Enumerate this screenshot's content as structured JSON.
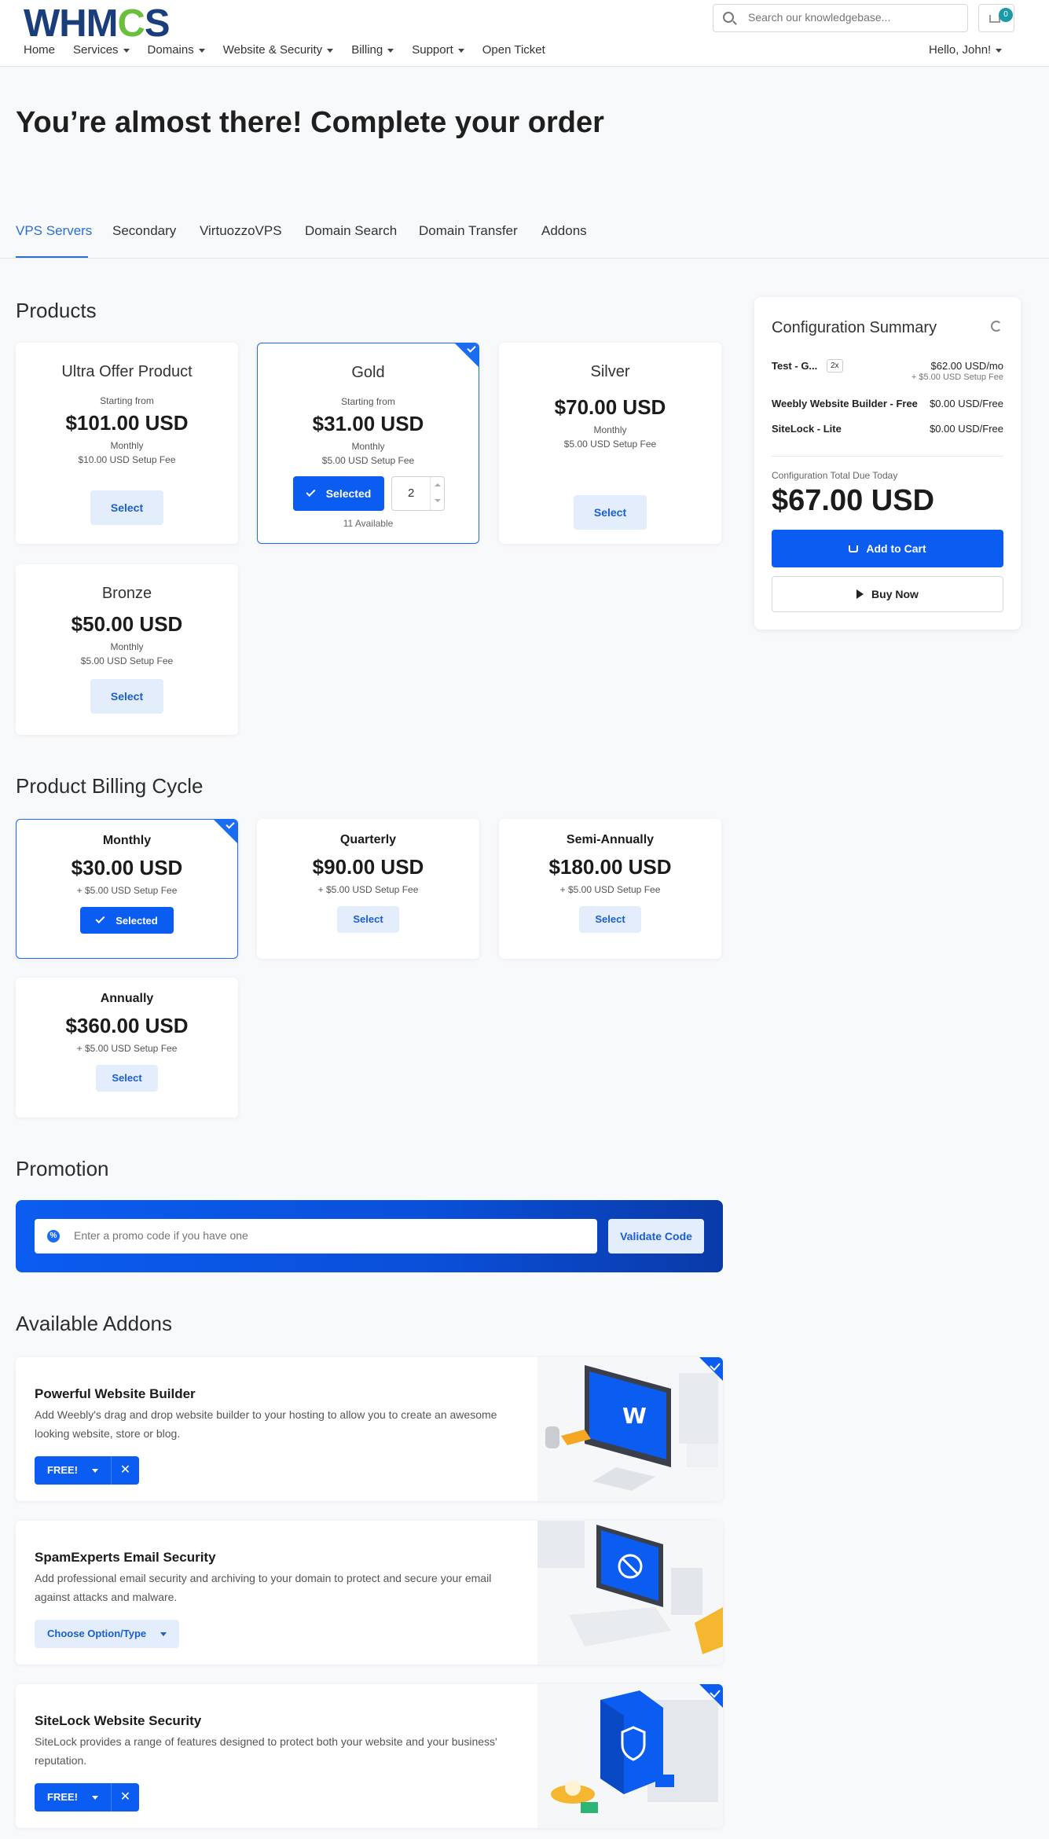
{
  "brand": {
    "logo_text_a": "WHM",
    "logo_text_b": "C",
    "logo_text_c": "S"
  },
  "header": {
    "search_placeholder": "Search our knowledgebase...",
    "cart_count": "0",
    "nav": [
      {
        "label": "Home",
        "dropdown": false
      },
      {
        "label": "Services",
        "dropdown": true
      },
      {
        "label": "Domains",
        "dropdown": true
      },
      {
        "label": "Website & Security",
        "dropdown": true
      },
      {
        "label": "Billing",
        "dropdown": true
      },
      {
        "label": "Support",
        "dropdown": true
      },
      {
        "label": "Open Ticket",
        "dropdown": false
      }
    ],
    "greeting": "Hello, John!"
  },
  "page": {
    "title": "You’re almost there! Complete your order"
  },
  "tabs": [
    "VPS Servers",
    "Secondary",
    "VirtuozzoVPS",
    "Domain Search",
    "Domain Transfer",
    "Addons"
  ],
  "products": {
    "heading": "Products",
    "items": [
      {
        "name": "Ultra Offer Product",
        "from": "Starting from",
        "price": "$101.00 USD",
        "cycle": "Monthly",
        "setup": "$10.00 USD Setup Fee",
        "button": "Select"
      },
      {
        "name": "Gold",
        "from": "Starting from",
        "price": "$31.00 USD",
        "cycle": "Monthly",
        "setup": "$5.00 USD Setup Fee",
        "button": "Selected",
        "qty": "2",
        "available": "11 Available"
      },
      {
        "name": "Silver",
        "price": "$70.00 USD",
        "cycle": "Monthly",
        "setup": "$5.00 USD Setup Fee",
        "button": "Select"
      },
      {
        "name": "Bronze",
        "price": "$50.00 USD",
        "cycle": "Monthly",
        "setup": "$5.00 USD Setup Fee",
        "button": "Select"
      }
    ]
  },
  "billing": {
    "heading": "Product Billing Cycle",
    "items": [
      {
        "name": "Monthly",
        "price": "$30.00 USD",
        "setup": "+ $5.00 USD Setup Fee",
        "button": "Selected"
      },
      {
        "name": "Quarterly",
        "price": "$90.00 USD",
        "setup": "+ $5.00 USD Setup Fee",
        "button": "Select"
      },
      {
        "name": "Semi-Annually",
        "price": "$180.00 USD",
        "setup": "+ $5.00 USD Setup Fee",
        "button": "Select"
      },
      {
        "name": "Annually",
        "price": "$360.00 USD",
        "setup": "+ $5.00 USD Setup Fee",
        "button": "Select"
      }
    ]
  },
  "promotion": {
    "heading": "Promotion",
    "placeholder": "Enter a promo code if you have one",
    "button": "Validate Code"
  },
  "addons": {
    "heading": "Available Addons",
    "items": [
      {
        "name": "Powerful Website Builder",
        "desc": "Add Weebly's drag and drop website builder to your hosting to allow you to create an awesome looking website, store or blog.",
        "button": "FREE!",
        "selected": true
      },
      {
        "name": "SpamExperts Email Security",
        "desc": "Add professional email security and archiving to your domain to protect and secure your email against attacks and malware.",
        "button": "Choose Option/Type",
        "selected": false
      },
      {
        "name": "SiteLock Website Security",
        "desc": "SiteLock provides a range of features designed to protect both your website and your business' reputation.",
        "button": "FREE!",
        "selected": true
      }
    ]
  },
  "summary": {
    "title": "Configuration Summary",
    "rows": [
      {
        "label": "Test - G...",
        "qty": "2x",
        "value": "$62.00 USD/mo",
        "sub": "+ $5.00 USD Setup Fee"
      },
      {
        "label": "Weebly Website Builder - Free",
        "value": "$0.00 USD/Free"
      },
      {
        "label": "SiteLock - Lite",
        "value": "$0.00 USD/Free"
      }
    ],
    "total_label": "Configuration Total Due Today",
    "total": "$67.00 USD",
    "add_to_cart": "Add to Cart",
    "buy_now": "Buy Now"
  },
  "colors": {
    "accent": "#0b5cf0",
    "accent_light": "#e4edfb",
    "logo": "#1a3d7c",
    "logo_gear": "#6abf3b"
  }
}
